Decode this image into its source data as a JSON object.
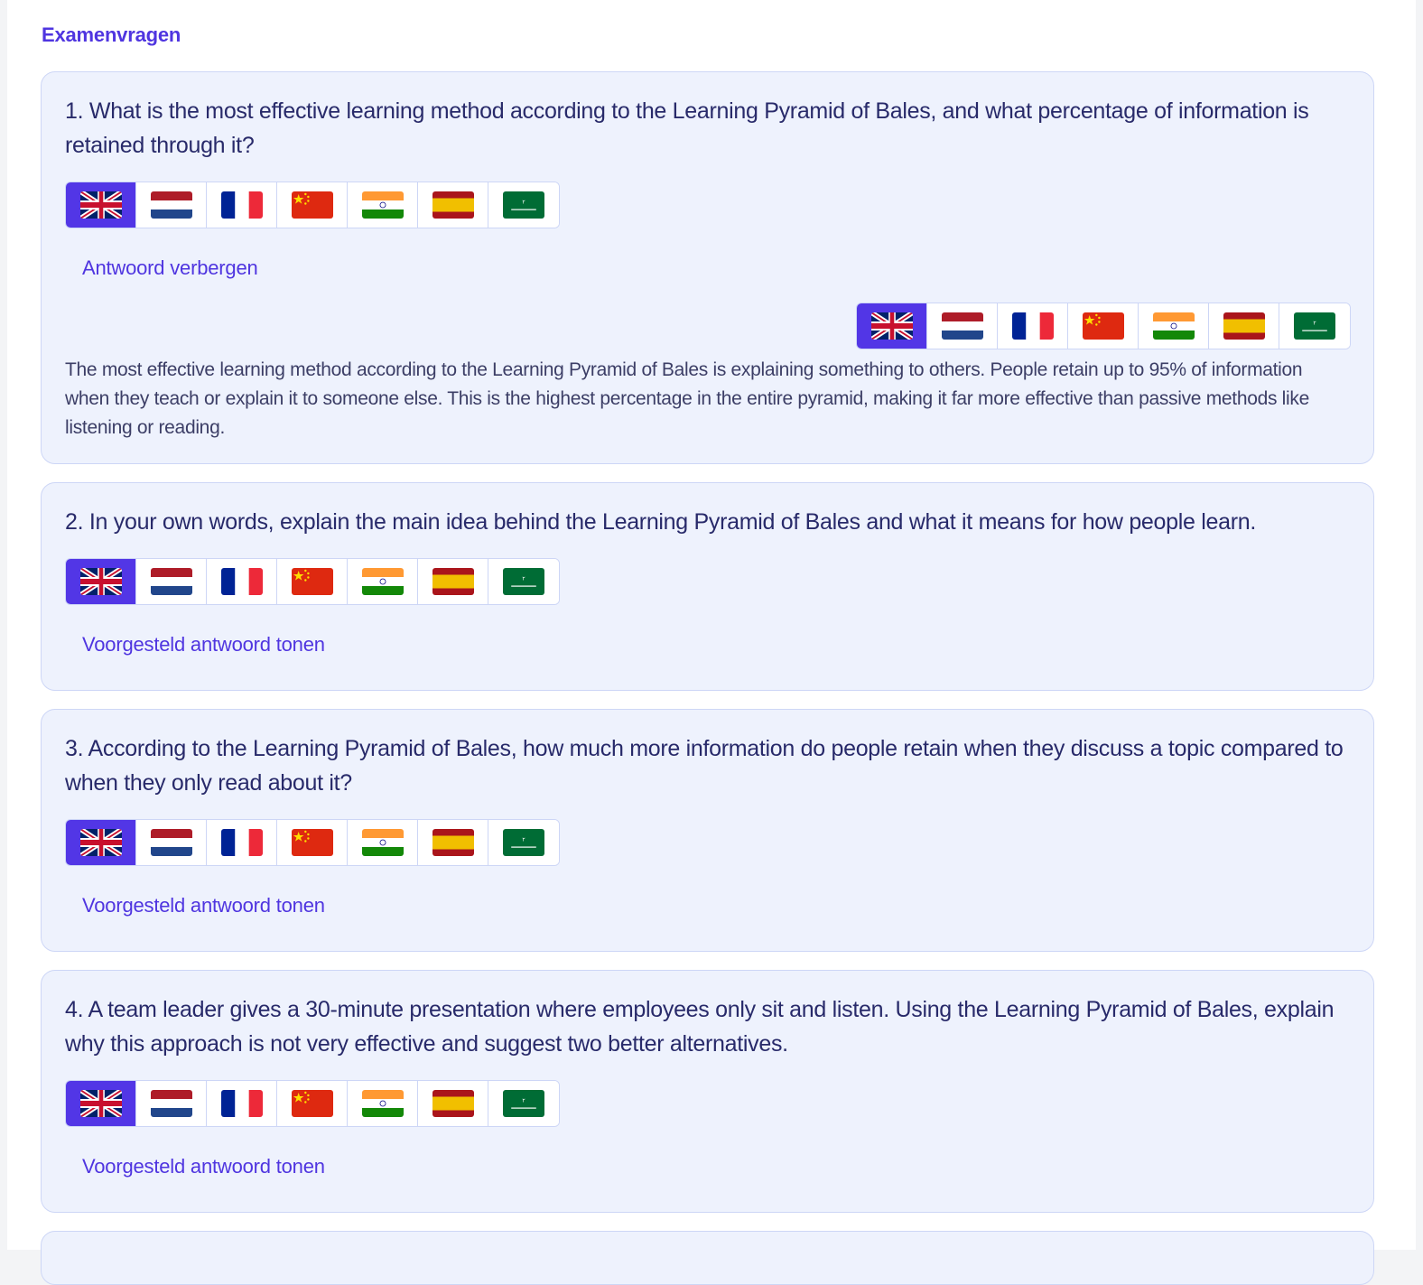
{
  "section_title": "Examenvragen",
  "flag_icons": [
    "uk-flag-icon",
    "netherlands-flag-icon",
    "france-flag-icon",
    "china-flag-icon",
    "india-flag-icon",
    "spain-flag-icon",
    "saudi-arabia-flag-icon"
  ],
  "active_flag": "uk-flag-icon",
  "colors": {
    "accent": "#4f35e0",
    "card_bg": "#eef2fd",
    "card_border": "#cdd6f6",
    "active_flag_bg": "#5236e6"
  },
  "questions": [
    {
      "text": "1. What is the most effective learning method according to the Learning Pyramid of Bales, and what percentage of information is retained through it?",
      "toggle_label": "Antwoord verbergen",
      "answer": "The most effective learning method according to the Learning Pyramid of Bales is explaining something to others. People retain up to 95% of information when they teach or explain it to someone else. This is the highest percentage in the entire pyramid, making it far more effective than passive methods like listening or reading."
    },
    {
      "text": "2. In your own words, explain the main idea behind the Learning Pyramid of Bales and what it means for how people learn.",
      "toggle_label": "Voorgesteld antwoord tonen"
    },
    {
      "text": "3. According to the Learning Pyramid of Bales, how much more information do people retain when they discuss a topic compared to when they only read about it?",
      "toggle_label": "Voorgesteld antwoord tonen"
    },
    {
      "text": "4. A team leader gives a 30-minute presentation where employees only sit and listen. Using the Learning Pyramid of Bales, explain why this approach is not very effective and suggest two better alternatives.",
      "toggle_label": "Voorgesteld antwoord tonen"
    }
  ]
}
